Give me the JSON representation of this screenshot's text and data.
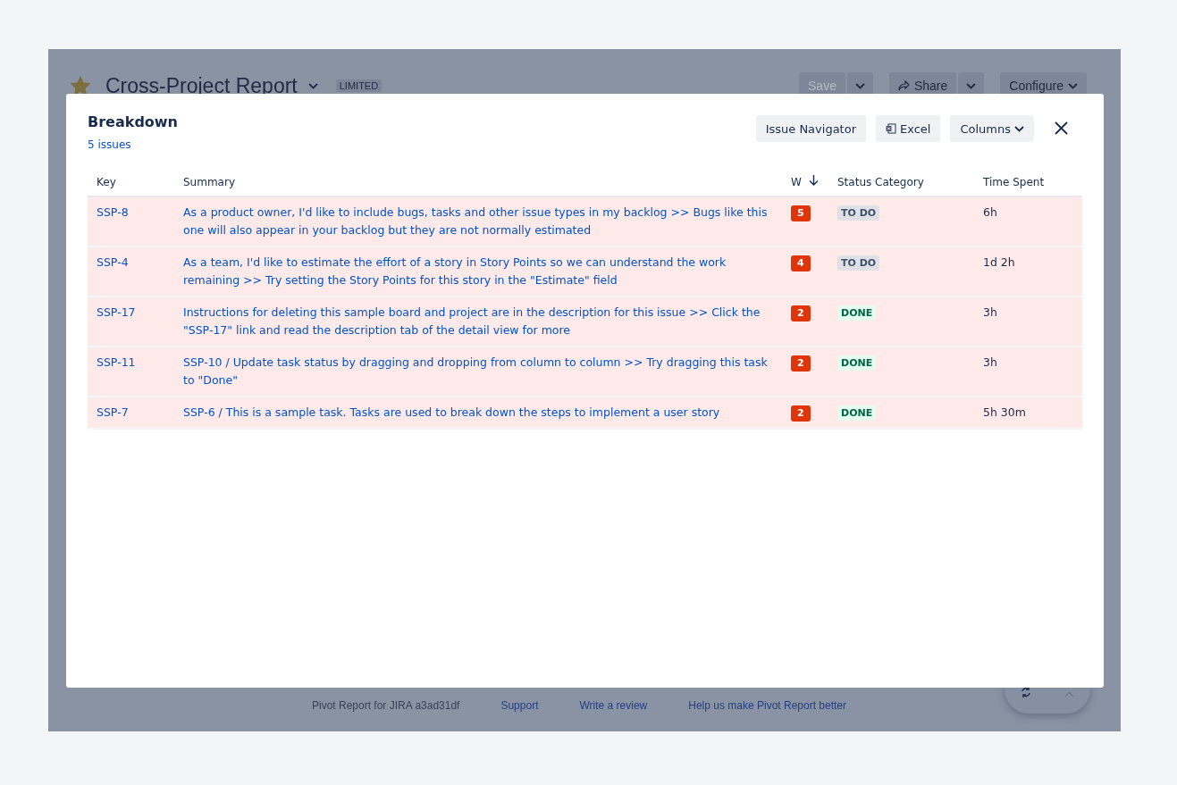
{
  "page": {
    "title": "Cross-Project Report",
    "badge": "LIMITED",
    "actions": [
      {
        "label": "Save",
        "disabled": true,
        "kind": "split"
      },
      {
        "label": "Share",
        "disabled": false,
        "kind": "share"
      },
      {
        "label": "Configure",
        "disabled": false,
        "kind": "dropdown"
      }
    ]
  },
  "dialog": {
    "title": "Breakdown",
    "count": "5 issues",
    "buttons": [
      {
        "label": "Issue Navigator",
        "kind": "plain"
      },
      {
        "label": "Excel",
        "kind": "excel"
      },
      {
        "label": "Columns",
        "kind": "dropdown"
      }
    ],
    "table": {
      "columns": [
        {
          "label": "Key",
          "sorted": false
        },
        {
          "label": "Summary",
          "sorted": false
        },
        {
          "label": "W",
          "sorted": true
        },
        {
          "label": "Status Category",
          "sorted": false
        },
        {
          "label": "Time Spent",
          "sorted": false
        }
      ],
      "rows": [
        {
          "key": "SSP-8",
          "summary": "As a product owner, I'd like to include bugs, tasks and other issue types in my backlog >> Bugs like this one will also appear in your backlog but they are not normally estimated",
          "w": "5",
          "status": {
            "label": "TO DO",
            "kind": "todo"
          },
          "time": "6h"
        },
        {
          "key": "SSP-4",
          "summary": "As a team, I'd like to estimate the effort of a story in Story Points so we can understand the work remaining >> Try setting the Story Points for this story in the \"Estimate\" field",
          "w": "4",
          "status": {
            "label": "TO DO",
            "kind": "todo"
          },
          "time": "1d 2h"
        },
        {
          "key": "SSP-17",
          "summary": "Instructions for deleting this sample board and project are in the description for this issue >> Click the \"SSP-17\" link and read the description tab of the detail view for more",
          "w": "2",
          "status": {
            "label": "DONE",
            "kind": "done"
          },
          "time": "3h"
        },
        {
          "key": "SSP-11",
          "summary": "SSP-10 /  Update task status by dragging and dropping from column to column >> Try dragging this task to \"Done\"",
          "w": "2",
          "status": {
            "label": "DONE",
            "kind": "done"
          },
          "time": "3h"
        },
        {
          "key": "SSP-7",
          "summary": "SSP-6 /  This is a sample task. Tasks are used to break down the steps to implement a user story",
          "w": "2",
          "status": {
            "label": "DONE",
            "kind": "done"
          },
          "time": "5h 30m"
        }
      ]
    }
  },
  "footer": {
    "version": "Pivot Report for JIRA a3ad31df",
    "links": [
      "Support",
      "Write a review",
      "Help us make Pivot Report better"
    ]
  }
}
